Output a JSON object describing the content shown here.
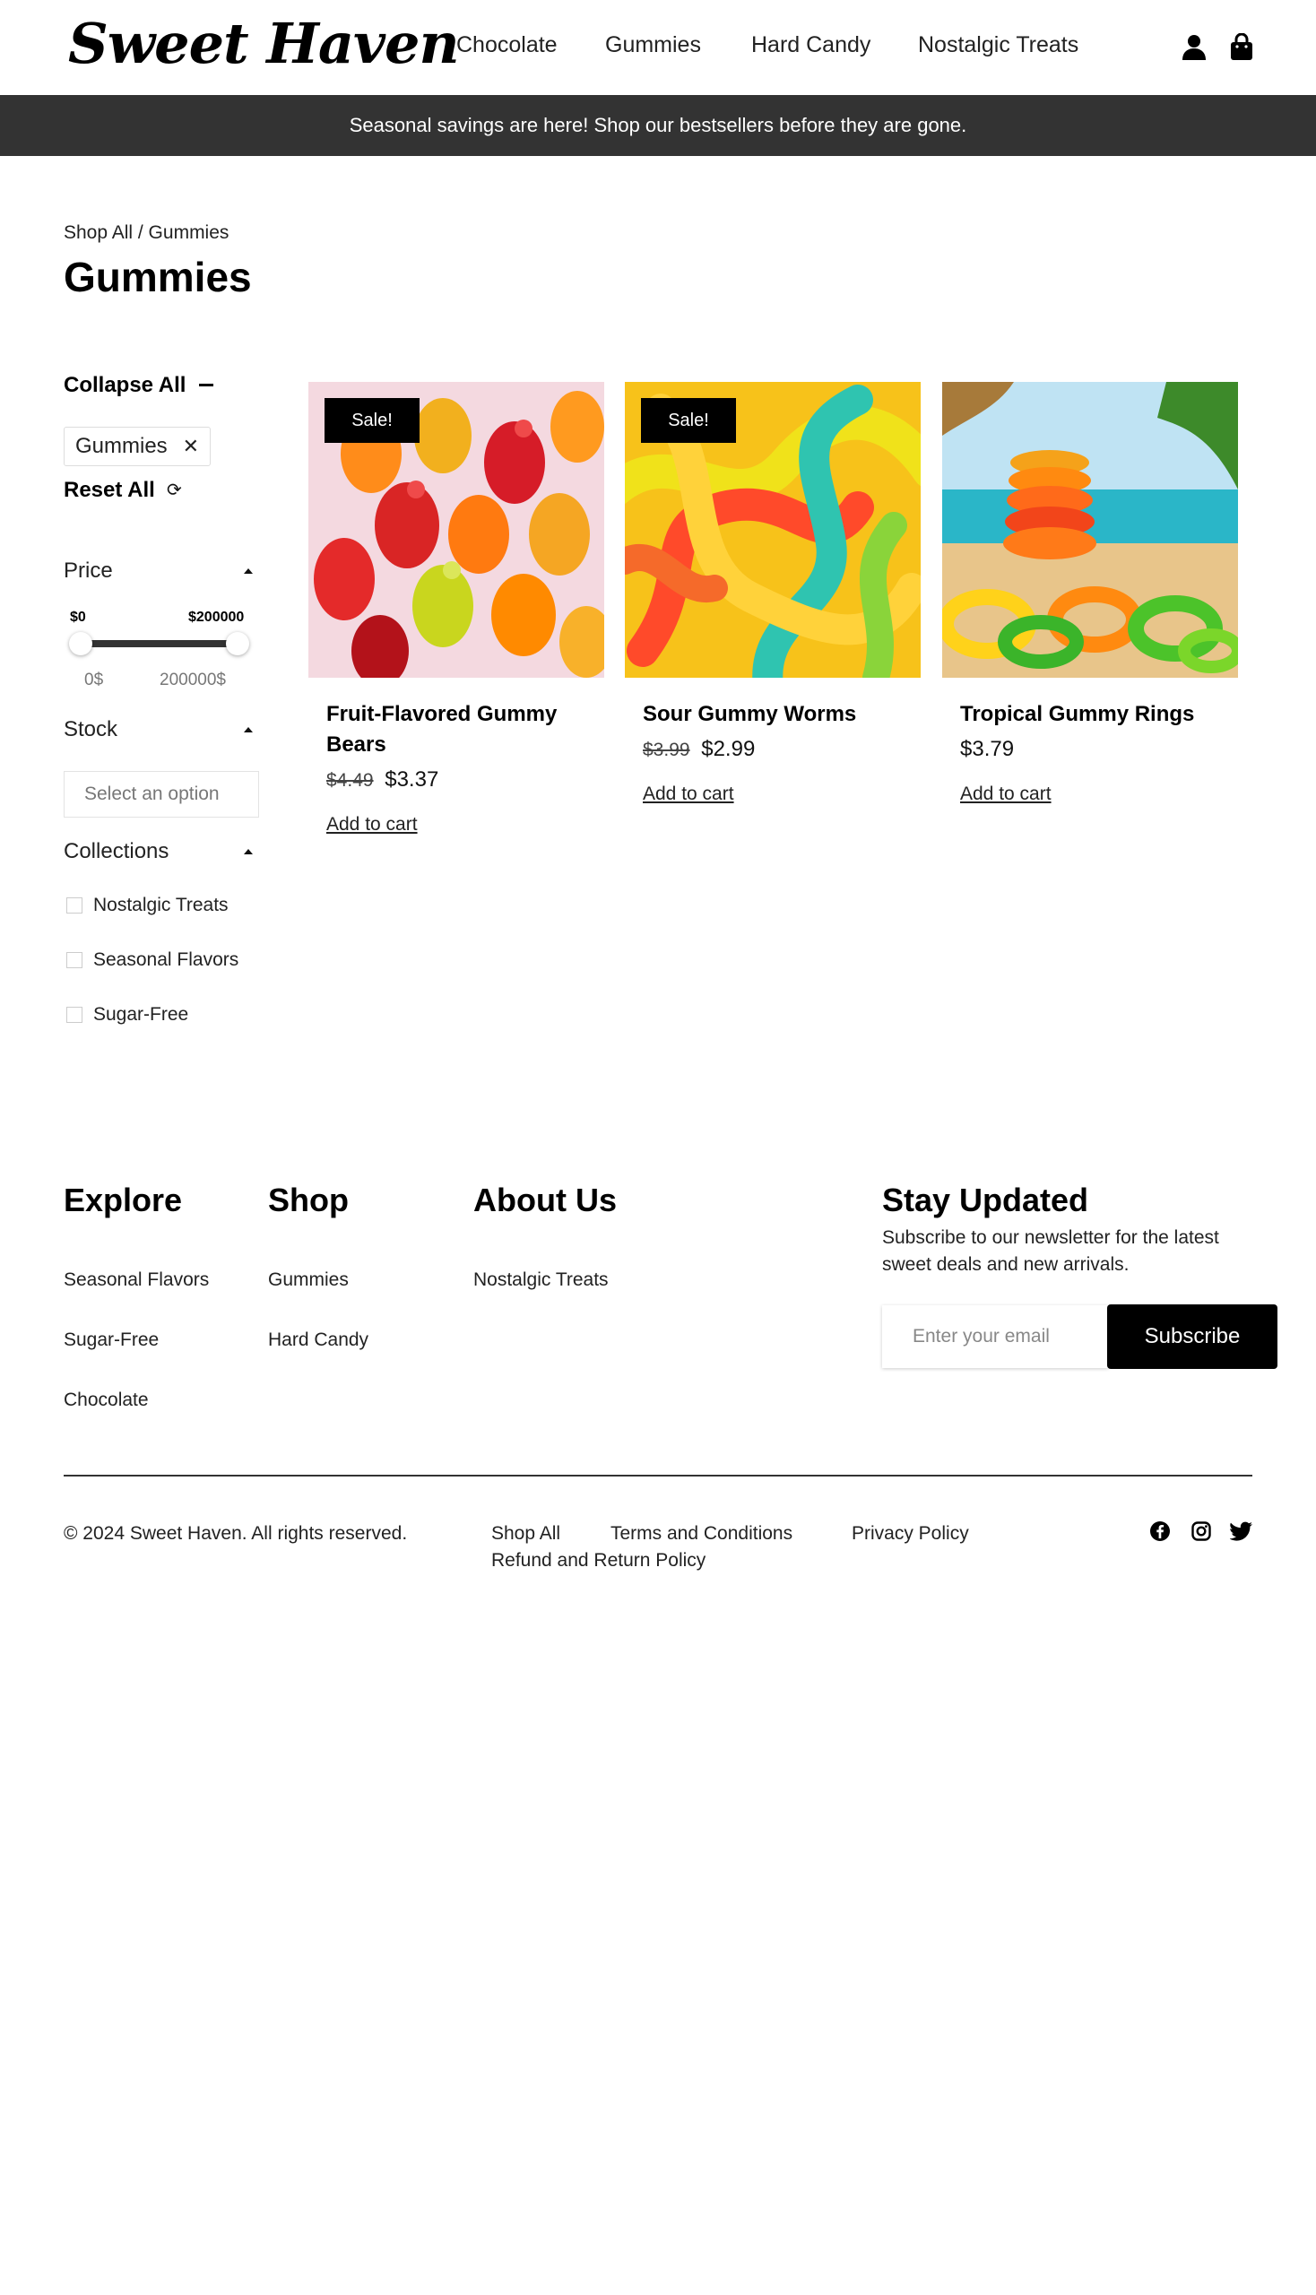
{
  "brand": {
    "name": "Sweet Haven"
  },
  "nav": {
    "items": [
      "Chocolate",
      "Gummies",
      "Hard Candy",
      "Nostalgic Treats"
    ]
  },
  "header_icons": [
    "user-icon",
    "shopping-bag-icon"
  ],
  "promo": {
    "text": "Seasonal savings are here! Shop our bestsellers before they are gone."
  },
  "breadcrumb": {
    "text": "Shop All / Gummies"
  },
  "page": {
    "title": "Gummies"
  },
  "filters": {
    "collapse_all": "Collapse All",
    "active_chip": "Gummies",
    "reset_all": "Reset All",
    "price": {
      "title": "Price",
      "min_label": "$0",
      "max_label": "$200000",
      "min_value": "0$",
      "max_value": "200000$",
      "range_min_fraction": 0,
      "range_max_fraction": 1
    },
    "stock": {
      "title": "Stock",
      "placeholder": "Select an option"
    },
    "collections": {
      "title": "Collections",
      "items": [
        "Nostalgic Treats",
        "Seasonal Flavors",
        "Sugar-Free"
      ]
    }
  },
  "products": [
    {
      "name": "Fruit-Flavored Gummy Bears",
      "badge": "Sale!",
      "old_price": "$4.49",
      "price": "$3.37",
      "cta": "Add to cart"
    },
    {
      "name": "Sour Gummy Worms",
      "badge": "Sale!",
      "old_price": "$3.99",
      "price": "$2.99",
      "cta": "Add to cart"
    },
    {
      "name": "Tropical Gummy Rings",
      "badge": "",
      "old_price": "",
      "price": "$3.79",
      "cta": "Add to cart"
    }
  ],
  "footer": {
    "explore": {
      "title": "Explore",
      "links": [
        "Seasonal Flavors",
        "Sugar-Free",
        "Chocolate"
      ]
    },
    "shop": {
      "title": "Shop",
      "links": [
        "Gummies",
        "Hard Candy"
      ]
    },
    "about": {
      "title": "About Us",
      "links": [
        "Nostalgic Treats"
      ]
    },
    "newsletter": {
      "title": "Stay Updated",
      "description": "Subscribe to our newsletter for the latest sweet deals and new arrivals.",
      "placeholder": "Enter your email",
      "button": "Subscribe"
    },
    "copyright": "© 2024 Sweet Haven. All rights reserved.",
    "legal_links": [
      "Shop All",
      "Terms and Conditions",
      "Privacy Policy",
      "Refund and Return Policy"
    ],
    "social_icons": [
      "facebook-icon",
      "instagram-icon",
      "twitter-icon"
    ]
  },
  "colors": {
    "promo_bar": "#333333",
    "badge": "#000000",
    "button": "#000000"
  }
}
